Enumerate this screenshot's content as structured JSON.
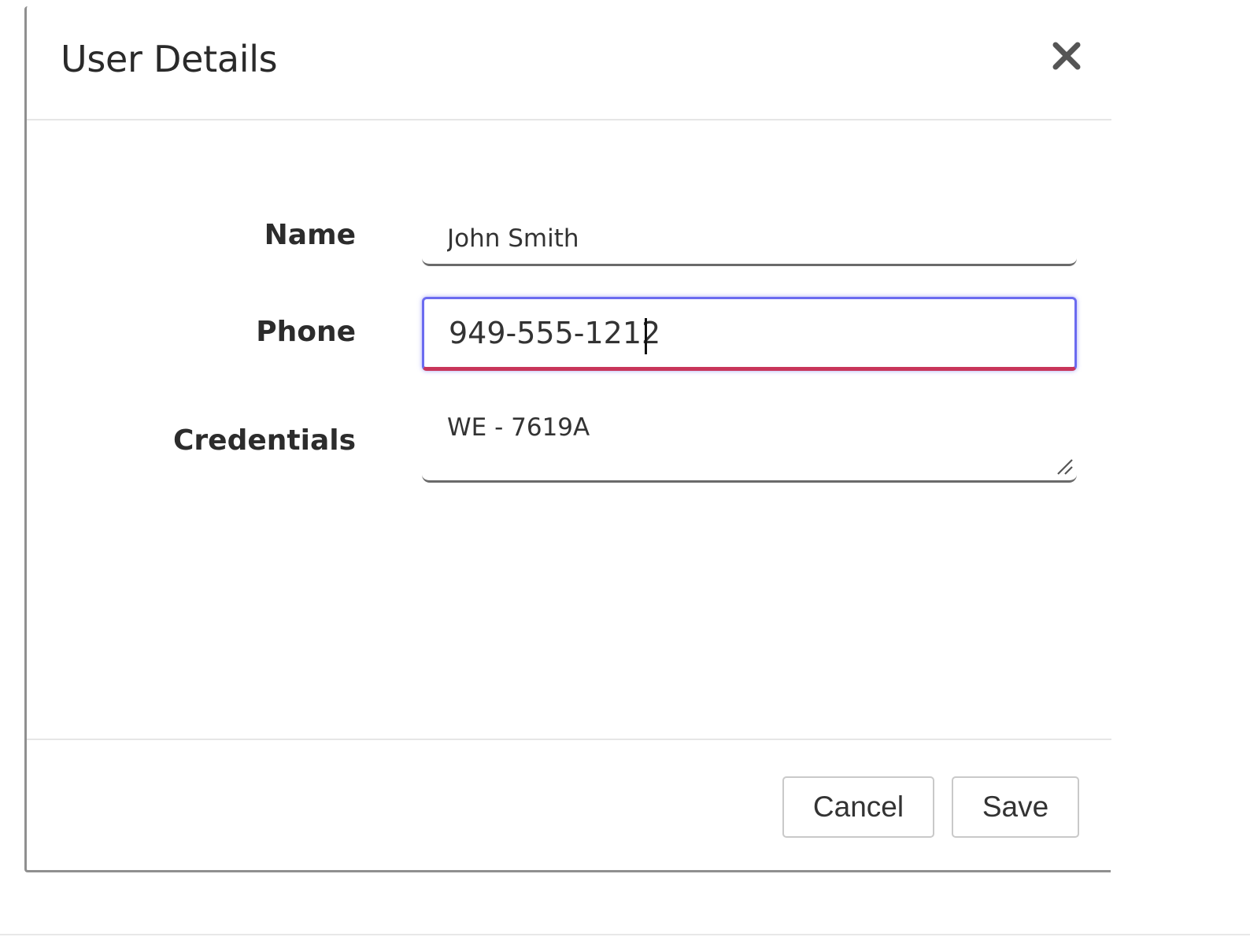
{
  "dialog": {
    "title": "User Details",
    "close_icon": "close-icon"
  },
  "form": {
    "name": {
      "label": "Name",
      "value": "John Smith"
    },
    "phone": {
      "label": "Phone",
      "value": "949-555-1212"
    },
    "credentials": {
      "label": "Credentials",
      "value": "WE - 7619A"
    }
  },
  "footer": {
    "cancel_label": "Cancel",
    "save_label": "Save"
  },
  "colors": {
    "focus_border": "#6b6bf0",
    "invalid_underline": "#c8355a"
  }
}
